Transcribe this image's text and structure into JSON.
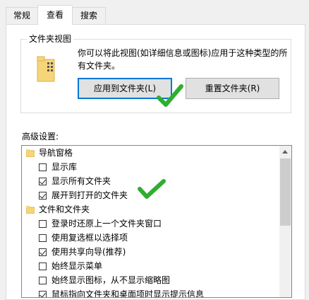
{
  "tabs": [
    {
      "label": "常规"
    },
    {
      "label": "查看"
    },
    {
      "label": "搜索"
    }
  ],
  "folder_views": {
    "title": "文件夹视图",
    "description": "你可以将此视图(如详细信息或图标)应用于这种类型的所有文件夹。",
    "apply_button": "应用到文件夹(L)",
    "reset_button": "重置文件夹(R)"
  },
  "advanced": {
    "label": "高级设置:",
    "items": [
      {
        "type": "category",
        "label": "导航窗格",
        "icon": "navigation-pane-icon"
      },
      {
        "type": "checkbox",
        "label": "显示库",
        "checked": false
      },
      {
        "type": "checkbox",
        "label": "显示所有文件夹",
        "checked": true
      },
      {
        "type": "checkbox",
        "label": "展开到打开的文件夹",
        "checked": true
      },
      {
        "type": "category",
        "label": "文件和文件夹",
        "icon": "folder-icon"
      },
      {
        "type": "checkbox",
        "label": "登录时还原上一个文件夹窗口",
        "checked": false
      },
      {
        "type": "checkbox",
        "label": "使用复选框以选择项",
        "checked": false
      },
      {
        "type": "checkbox",
        "label": "使用共享向导(推荐)",
        "checked": true
      },
      {
        "type": "checkbox",
        "label": "始终显示菜单",
        "checked": false
      },
      {
        "type": "checkbox",
        "label": "始终显示图标，从不显示缩略图",
        "checked": false
      },
      {
        "type": "checkbox",
        "label": "鼠标指向文件夹和桌面项时显示提示信息",
        "checked": true
      }
    ]
  },
  "colors": {
    "accent": "#0078d7",
    "green_check": "#2fae2f"
  }
}
